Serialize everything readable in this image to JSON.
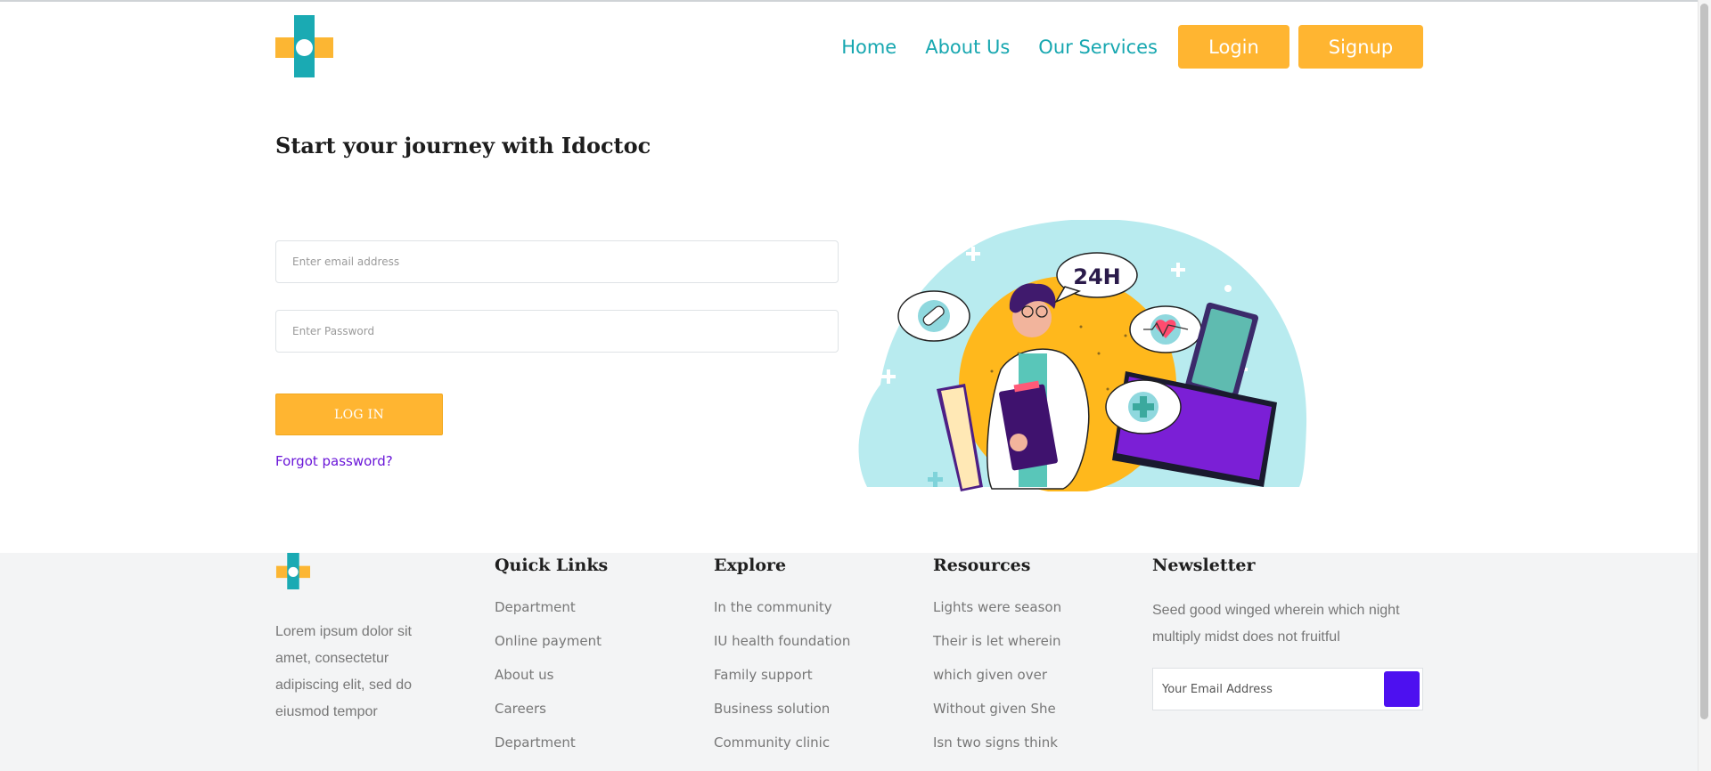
{
  "header": {
    "nav": [
      {
        "label": "Home"
      },
      {
        "label": "About Us"
      },
      {
        "label": "Our Services"
      }
    ],
    "login_button": "Login",
    "signup_button": "Signup"
  },
  "main": {
    "title": "Start your journey with Idoctoc",
    "email_placeholder": "Enter email address",
    "password_placeholder": "Enter Password",
    "submit_label": "LOG IN",
    "forgot_link": "Forgot password?",
    "illustration_badge": "24H"
  },
  "footer": {
    "about_text": "Lorem ipsum dolor sit amet, consectetur adipiscing elit, sed do eiusmod tempor",
    "columns": [
      {
        "title": "Quick Links",
        "items": [
          "Department",
          "Online payment",
          "About us",
          "Careers",
          "Department"
        ]
      },
      {
        "title": "Explore",
        "items": [
          "In the community",
          "IU health foundation",
          "Family support",
          "Business solution",
          "Community clinic"
        ]
      },
      {
        "title": "Resources",
        "items": [
          "Lights were season",
          "Their is let wherein",
          "which given over",
          "Without given She",
          "Isn two signs think"
        ]
      }
    ],
    "newsletter": {
      "title": "Newsletter",
      "text": "Seed good winged wherein which night multiply midst does not fruitful",
      "placeholder": "Your Email Address"
    }
  },
  "colors": {
    "accent": "#ffb531",
    "brand_teal": "#17a7b0",
    "link_purple": "#6a16d8",
    "subscribe_button": "#4d10f0"
  },
  "icons": [
    "plus-logo-icon",
    "send-icon"
  ]
}
